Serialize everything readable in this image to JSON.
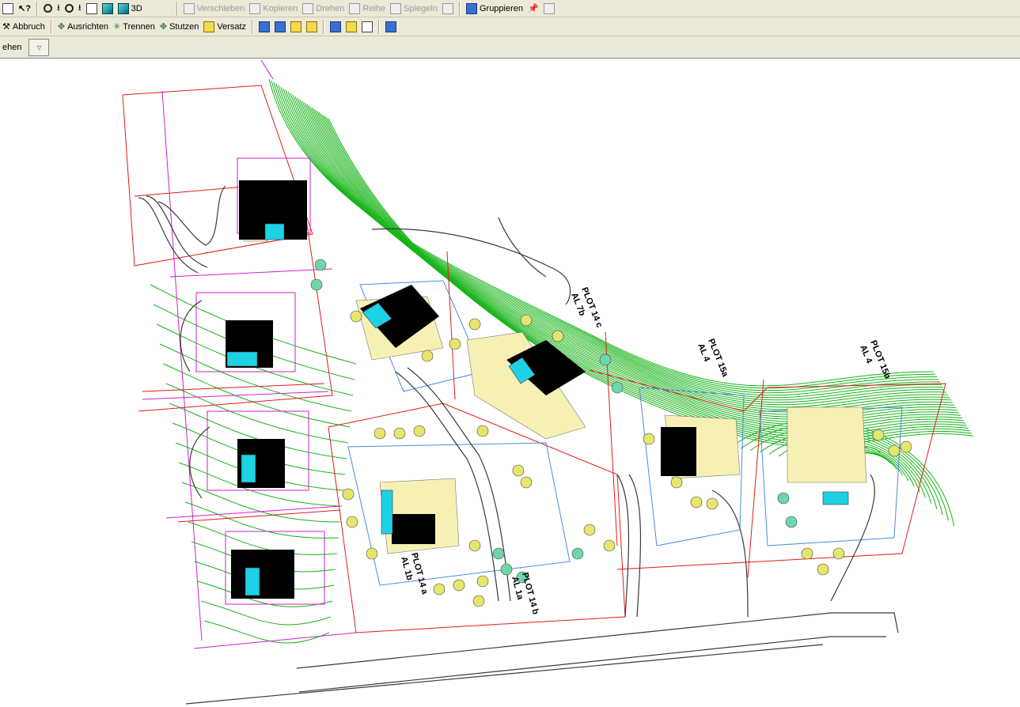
{
  "toolbar1": {
    "view3d": "3D",
    "move": "Verschieben",
    "copy": "Kopieren",
    "rotate": "Drehen",
    "row": "Reihe",
    "mirror": "Spiegeln",
    "group": "Gruppieren"
  },
  "toolbar2": {
    "cancel": "Abbruch",
    "align": "Ausrichten",
    "split": "Trennen",
    "columns": "Stutzen",
    "offset": "Versatz"
  },
  "toolbar3": {
    "partial": "ehen"
  },
  "drawing": {
    "colors": {
      "contour": "#18b418",
      "boundary": "#e01b1b",
      "building": "#000000",
      "pool": "#1ed2e6",
      "terrace": "#f7f0b4",
      "tree": "#e6e66e",
      "shrub": "#6ed7aa",
      "magenta": "#d21ed2",
      "road": "#3a3a3a",
      "blueline": "#4a8be0"
    },
    "labels": [
      {
        "text": "PLOT 14 c"
      },
      {
        "text": "AL 7b"
      },
      {
        "text": "PLOT 15a"
      },
      {
        "text": "AL 4"
      },
      {
        "text": "PLOT 15b"
      },
      {
        "text": "AL 4"
      },
      {
        "text": "PLOT 14 a"
      },
      {
        "text": "AL 1b"
      },
      {
        "text": "PLOT 14 b"
      },
      {
        "text": "AL 1a"
      }
    ]
  }
}
